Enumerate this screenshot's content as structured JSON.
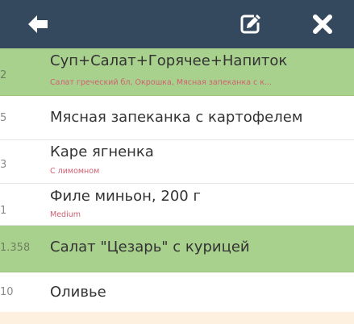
{
  "toolbar": {
    "back_icon": "arrow-left-icon",
    "edit_icon": "edit-icon",
    "close_icon": "close-icon"
  },
  "colors": {
    "toolbar_bg": "#34495e",
    "highlight_row": "#a9d18e",
    "modifier_text": "#d06070"
  },
  "items": [
    {
      "qty": "2",
      "title": "Суп+Салат+Горячее+Напиток",
      "modifier": "Салат греческий бл, Окрошка, Мясная запеканка с к..."
    },
    {
      "qty": "5",
      "title": "Мясная запеканка с картофелем",
      "modifier": ""
    },
    {
      "qty": "3",
      "title": "Каре ягненка",
      "modifier": "С лимомном"
    },
    {
      "qty": "1",
      "title": "Филе миньон, 200 г",
      "modifier": "Medium"
    },
    {
      "qty": "1.358",
      "title": "Салат \"Цезарь\" с курицей",
      "modifier": ""
    },
    {
      "qty": "10",
      "title": "Оливье",
      "modifier": ""
    }
  ]
}
